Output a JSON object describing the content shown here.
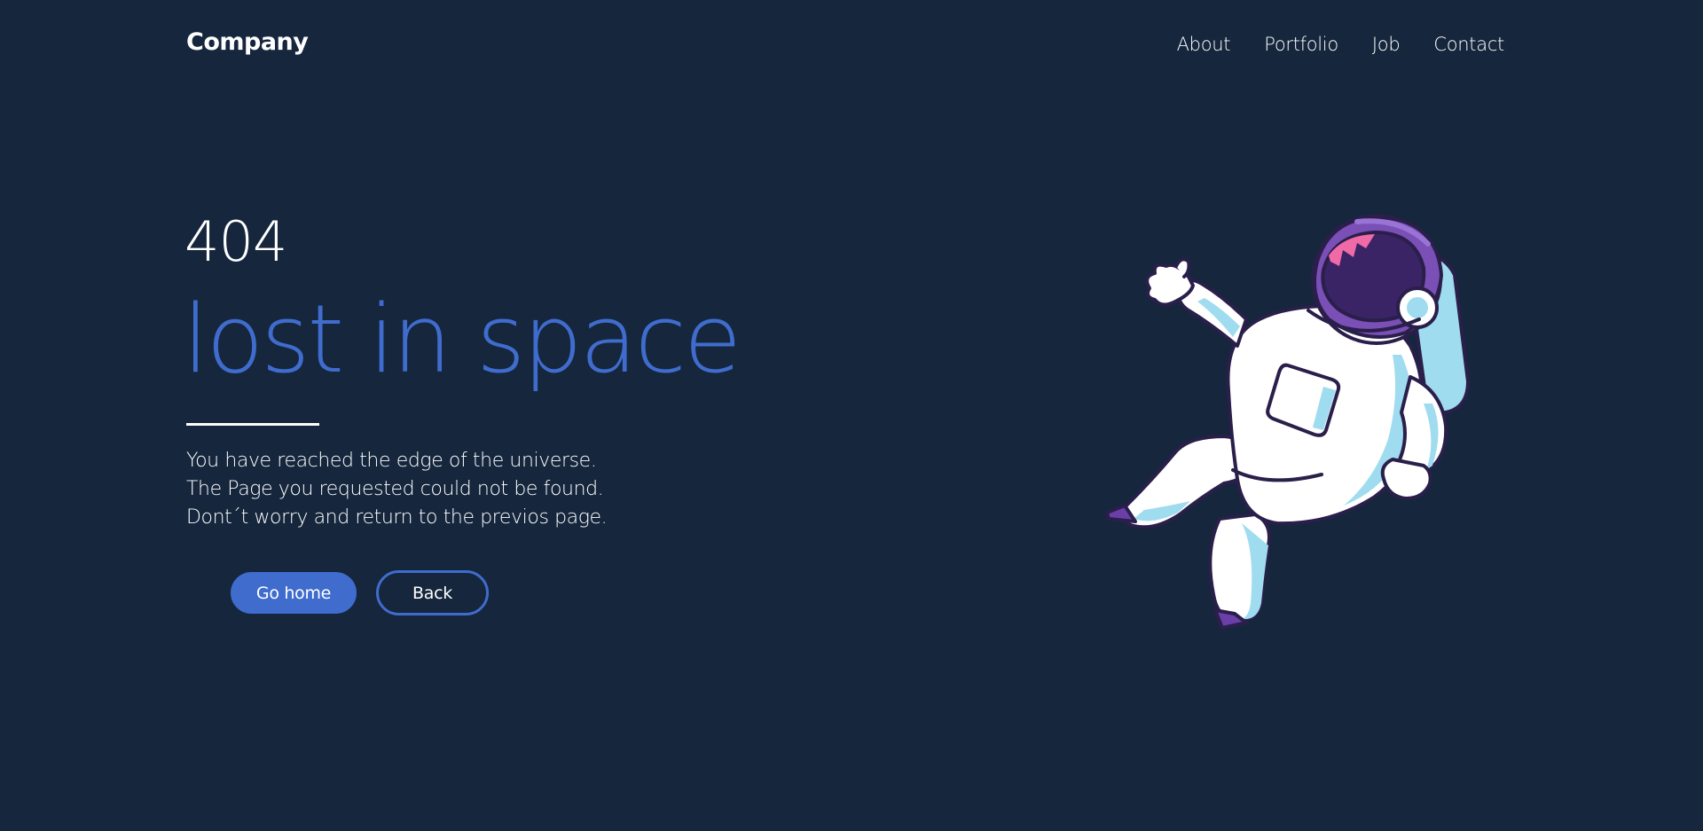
{
  "header": {
    "logo": "Company",
    "nav": [
      "About",
      "Portfolio",
      "Job",
      "Contact"
    ]
  },
  "main": {
    "code": "404",
    "headline": "lost in space",
    "message_lines": [
      "You have reached the edge of the universe.",
      "The Page you requested could not be found.",
      "Dont´t worry and return to the previos page."
    ],
    "buttons": {
      "home_label": "Go home",
      "back_label": "Back"
    }
  },
  "illustration": {
    "icon": "astronaut-illustration"
  },
  "colors": {
    "background": "#15263d",
    "accent": "#3f6ccd",
    "text": "#ffffff",
    "suit_shadow": "#9fdcef",
    "helmet_purple": "#7a4fb6",
    "visor_pink": "#f06aa8"
  }
}
